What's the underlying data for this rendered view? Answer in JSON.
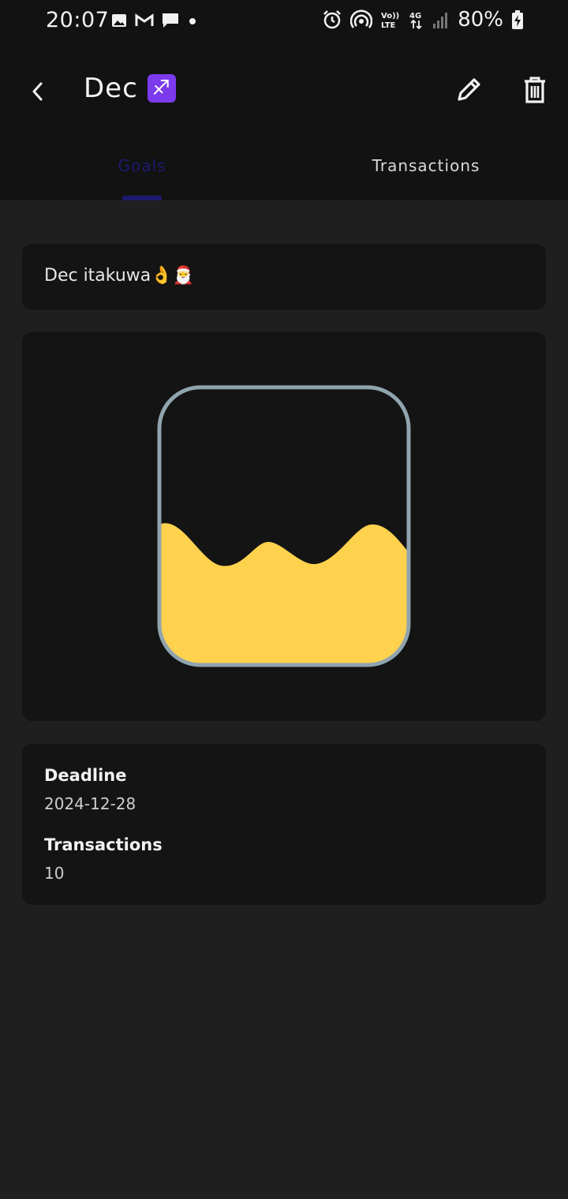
{
  "status_bar": {
    "time": "20:07",
    "left_icons": [
      "image-icon",
      "gmail-icon",
      "chat-icon",
      "dot-icon"
    ],
    "right_icons": [
      "alarm-icon",
      "hotspot-icon",
      "volte-icon",
      "4g-icon",
      "signal-icon"
    ],
    "battery": "80%"
  },
  "app_bar": {
    "title": "Dec",
    "zodiac_symbol": "♐",
    "zodiac_color": "#7c3aed"
  },
  "tabs": [
    {
      "label": "Goals",
      "active": true
    },
    {
      "label": "Transactions",
      "active": false
    }
  ],
  "goal": {
    "description": "Dec itakuwa👌🎅",
    "progress": 0.5,
    "fill_color": "#ffd24d",
    "outline_color": "#90a4ae",
    "deadline_label": "Deadline",
    "deadline_value": "2024-12-28",
    "transactions_label": "Transactions",
    "transactions_value": "10"
  },
  "colors": {
    "background": "#1f1f1f",
    "surface": "#141414",
    "accent": "#1c1a6e"
  }
}
